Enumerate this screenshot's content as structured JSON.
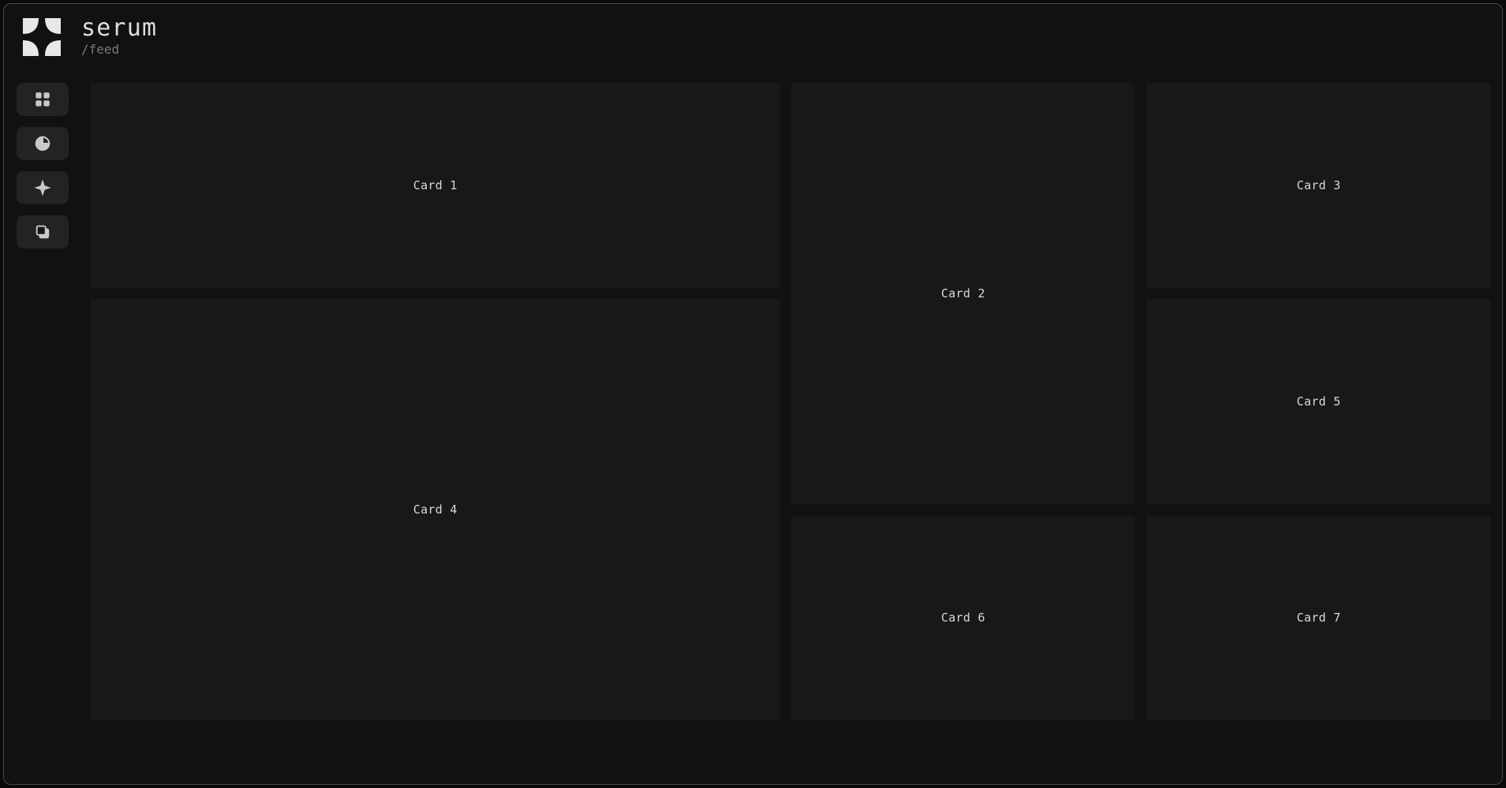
{
  "header": {
    "title": "serum",
    "subtitle": "/feed"
  },
  "sidebar": {
    "items": [
      {
        "name": "grid-icon"
      },
      {
        "name": "pie-icon"
      },
      {
        "name": "sparkle-icon"
      },
      {
        "name": "copy-icon"
      }
    ]
  },
  "cards": [
    {
      "label": "Card 1"
    },
    {
      "label": "Card 2"
    },
    {
      "label": "Card 3"
    },
    {
      "label": "Card 4"
    },
    {
      "label": "Card 5"
    },
    {
      "label": "Card 6"
    },
    {
      "label": "Card 7"
    }
  ]
}
